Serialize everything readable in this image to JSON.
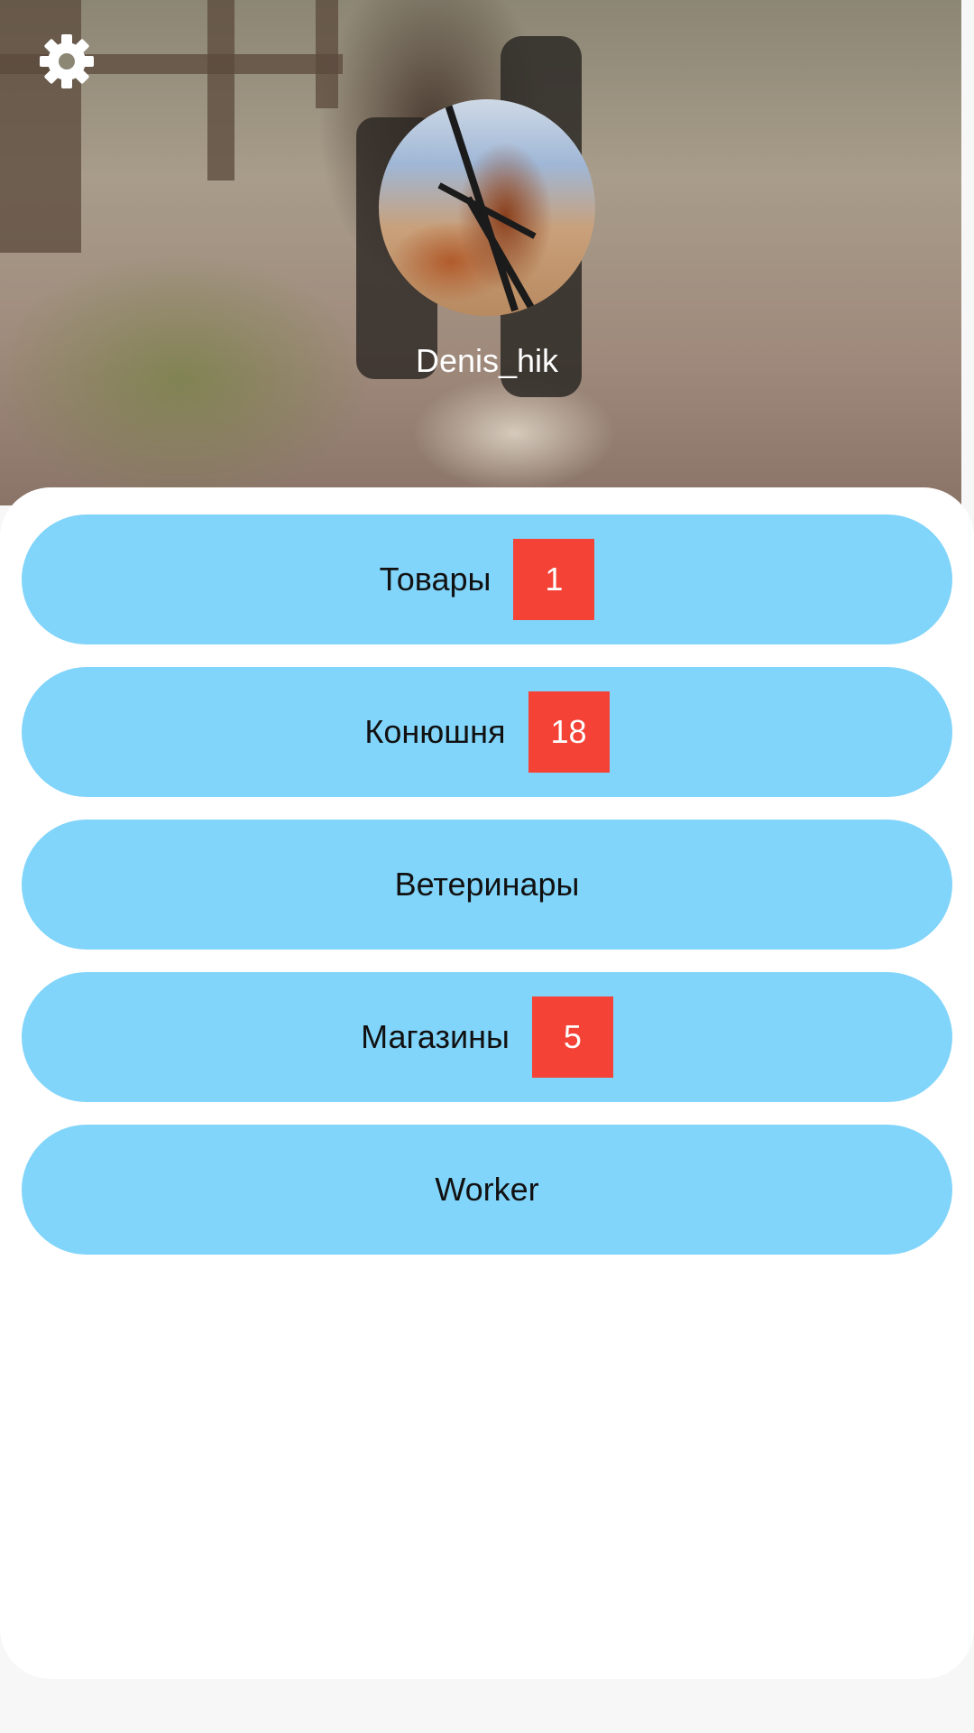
{
  "profile": {
    "username": "Denis_hik",
    "avatar_alt": "horse-photo"
  },
  "settings": {
    "icon": "gear-icon"
  },
  "menu": [
    {
      "label": "Товары",
      "badge": "1"
    },
    {
      "label": "Конюшня",
      "badge": "18"
    },
    {
      "label": "Ветеринары",
      "badge": ""
    },
    {
      "label": "Магазины",
      "badge": "5"
    },
    {
      "label": "Worker",
      "badge": ""
    }
  ],
  "colors": {
    "button_bg": "#81d4fa",
    "badge_bg": "#f44336",
    "card_bg": "#ffffff",
    "page_bg": "#f7f7f7"
  }
}
